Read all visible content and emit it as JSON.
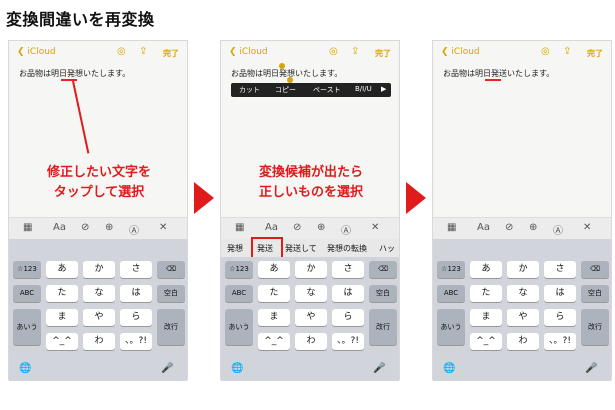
{
  "title": "変換間違いを再変換",
  "nav": {
    "back": "iCloud",
    "done": "完了"
  },
  "note_text": "お品物は明日発想いたします。",
  "note_text_fixed": "お品物は明日発送いたします。",
  "callout1": [
    "修正したい文字を",
    "タップして選択"
  ],
  "callout2": [
    "変換候補が出たら",
    "正しいものを選択"
  ],
  "popup": [
    "カット",
    "コピー",
    "ペースト",
    "B/I/U",
    "▶"
  ],
  "toolbar": [
    "▦",
    "Aa",
    "⊘",
    "⊕",
    "Ⓐ",
    "✕"
  ],
  "candidates": [
    "発想",
    "発送",
    "発送して",
    "発想の転換",
    "ハッ"
  ],
  "keys": {
    "row1": [
      "☆123",
      "あ",
      "か",
      "さ",
      "⌫"
    ],
    "row2": [
      "ABC",
      "た",
      "な",
      "は",
      "空白"
    ],
    "row3": [
      "あいう",
      "ま",
      "や",
      "ら",
      "改行"
    ],
    "row4": [
      "^_^",
      "わ",
      "、。?!"
    ]
  },
  "bottom": {
    "globe": "🌐",
    "mic": "🎤"
  }
}
